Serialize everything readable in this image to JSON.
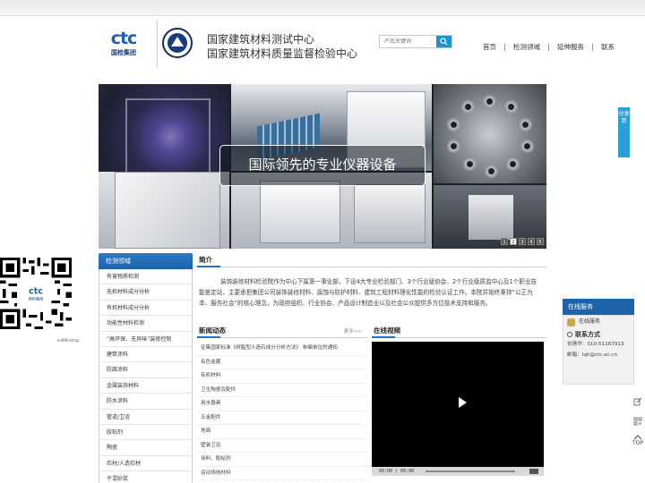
{
  "brand": {
    "logo_text": "ctc",
    "logo_sub": "国检集团",
    "org_name_1": "国家建筑材料测试中心",
    "org_name_2": "国家建筑材料质量监督检验中心"
  },
  "search": {
    "placeholder": "产品关键词"
  },
  "nav": {
    "items": [
      "首页",
      "检测领域",
      "延伸服务",
      "联系"
    ]
  },
  "banner": {
    "caption": "国际领先的专业仪器设备",
    "pages": [
      "1",
      "2",
      "3",
      "4",
      "5"
    ],
    "active_page": 2
  },
  "sidebar": {
    "title": "检测领域",
    "items": [
      "有害物质检测",
      "无机材料成分分析",
      "有机材料成分分析",
      "功能性材料检测",
      "“高环保、无异味”装修控制",
      "建筑涂料",
      "防腐涂料",
      "金属装饰材料",
      "防水涂料",
      "管道/卫浴",
      "胶粘剂",
      "陶瓷",
      "石材/人造石材",
      "干混砂浆"
    ]
  },
  "intro": {
    "title": "简介",
    "text": "装饰装修材料检验院作为中心下属第一事业部，下设4大专业检验部门、3个行业级协会、2个行业级质监中心及1个职业技能鉴定站，主要承担集团公司装饰装修材料、腐蚀与防护材料、建筑工程材料理化性能的检验认证工作。本院并始终秉持“公正为本、服务社会”的核心理念，为政府组织、行业协会、产品设计制造业以及社会公众提供多方位技术支持和服务。"
  },
  "news": {
    "title": "新闻动态",
    "more": "更多>>",
    "items": [
      "征集国家标准《树脂型人造石成分分析方法》 参编单位的通知",
      "有色金属",
      "有机材料",
      "卫生陶瓷及配件",
      "用水器具",
      "五金配件",
      "地面",
      "壁装卫浴",
      "涂料、胶粘剂",
      "运动场地材料"
    ]
  },
  "video": {
    "title": "在线视频",
    "time": "00:00 / 00:00"
  },
  "service": {
    "title": "在线服务",
    "online": "在线服务",
    "contact_title": "联系方式",
    "contact_person": "刘清华：010-51167913",
    "email": "邮箱：lqh@ctc.ac.cn"
  },
  "share": {
    "label": "分享到"
  },
  "tools": {
    "top": "TOP"
  },
  "qr": {
    "caption": "e-Wifinishop"
  },
  "colors": {
    "accent": "#1e63aa",
    "search_button": "#1f8fd6",
    "share_tab": "#2aa0d8"
  }
}
